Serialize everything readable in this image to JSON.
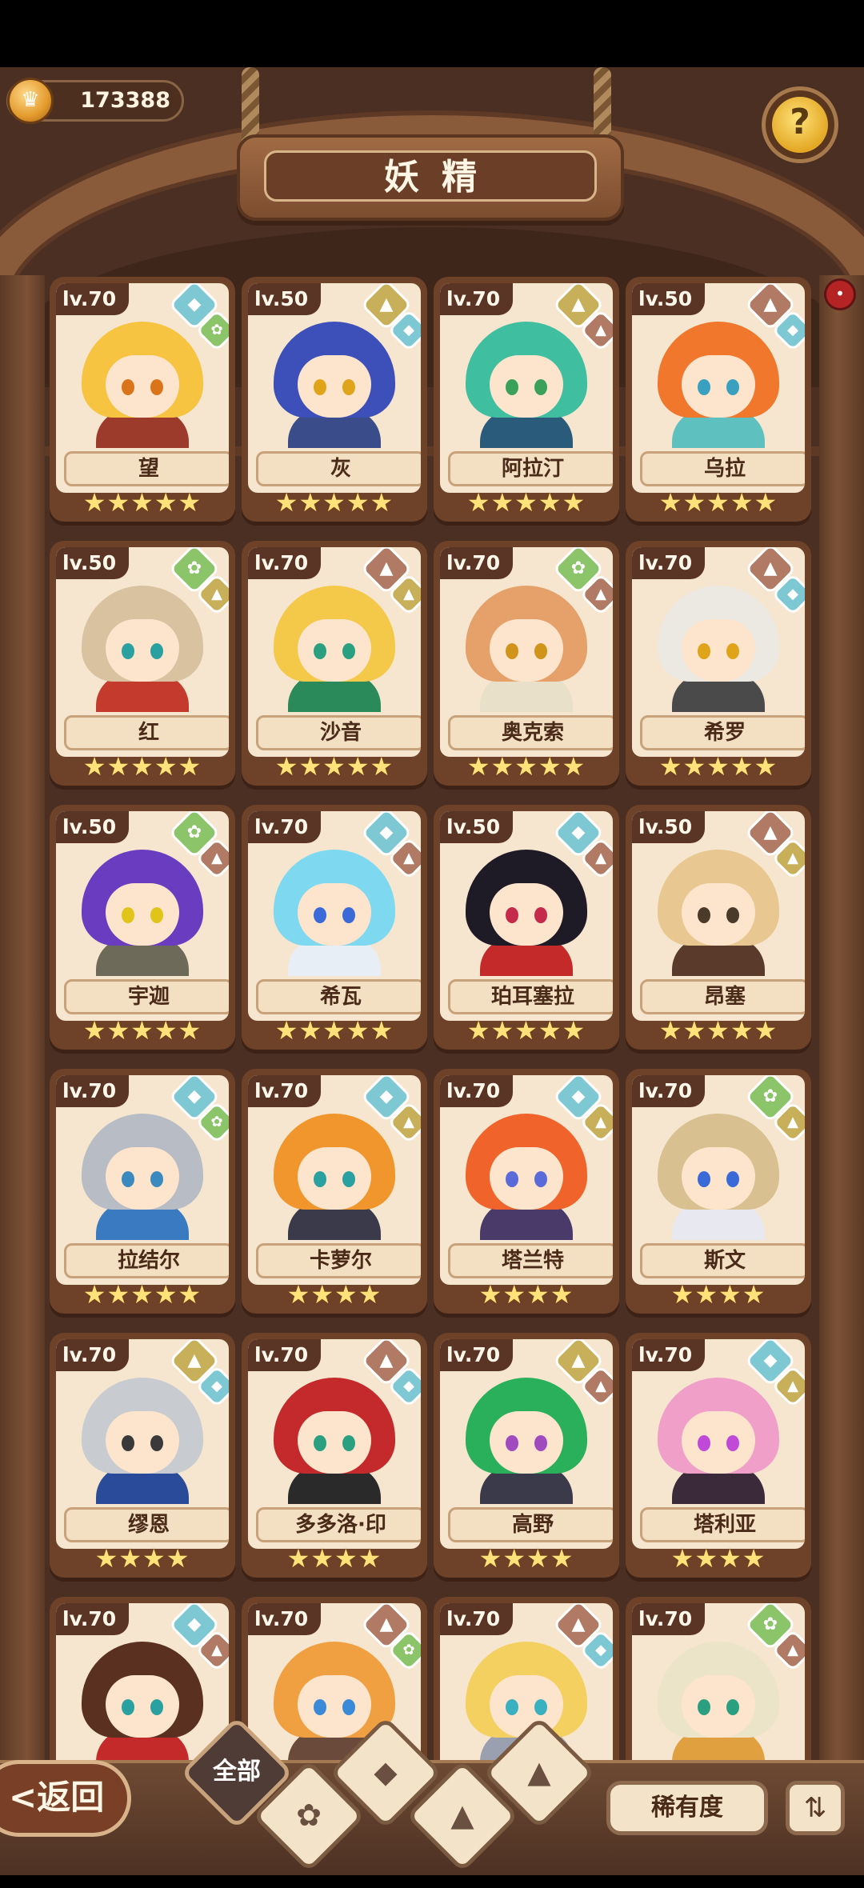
{
  "header": {
    "title": "妖精",
    "currency_value": "173388",
    "help_symbol": "?",
    "notification_mark": "•"
  },
  "footer": {
    "back_label": "<返回",
    "filter_all_label": "全部",
    "rarity_label": "稀有度",
    "sort_symbol": "⇅"
  },
  "element_colors": {
    "water": "#7ec8d4",
    "earth": "#c8b05a",
    "fire": "#b07a64",
    "nature": "#8cc46a"
  },
  "fairies": [
    {
      "level": "lv.70",
      "name": "望",
      "stars": "★★★★★",
      "elements": [
        "water",
        "nature"
      ],
      "hair": "#f6c441",
      "outfit": "#9c3a2c",
      "eye": "#d9741a"
    },
    {
      "level": "lv.50",
      "name": "灰",
      "stars": "★★★★★",
      "elements": [
        "earth",
        "water"
      ],
      "hair": "#3d4fb8",
      "outfit": "#3a4c8a",
      "eye": "#e0a41a"
    },
    {
      "level": "lv.70",
      "name": "阿拉汀",
      "stars": "★★★★★",
      "elements": [
        "earth",
        "fire"
      ],
      "hair": "#3fbfa0",
      "outfit": "#2a5b7a",
      "eye": "#3aa05a"
    },
    {
      "level": "lv.50",
      "name": "乌拉",
      "stars": "★★★★★",
      "elements": [
        "fire",
        "water"
      ],
      "hair": "#f0772c",
      "outfit": "#5fc0c0",
      "eye": "#3aa0c0"
    },
    {
      "level": "lv.50",
      "name": "红",
      "stars": "★★★★★",
      "elements": [
        "nature",
        "earth"
      ],
      "hair": "#d8c2a0",
      "outfit": "#c43a2c",
      "eye": "#2aa0a0"
    },
    {
      "level": "lv.70",
      "name": "沙音",
      "stars": "★★★★★",
      "elements": [
        "fire",
        "earth"
      ],
      "hair": "#f4c94a",
      "outfit": "#2a8a5a",
      "eye": "#2aa080"
    },
    {
      "level": "lv.70",
      "name": "奥克索",
      "stars": "★★★★★",
      "elements": [
        "nature",
        "fire"
      ],
      "hair": "#e6a06a",
      "outfit": "#e8e0c8",
      "eye": "#d0941a"
    },
    {
      "level": "lv.70",
      "name": "希罗",
      "stars": "★★★★★",
      "elements": [
        "fire",
        "water"
      ],
      "hair": "#ece8e2",
      "outfit": "#4a4a4a",
      "eye": "#e0a41a"
    },
    {
      "level": "lv.50",
      "name": "宇迦",
      "stars": "★★★★★",
      "elements": [
        "nature",
        "fire"
      ],
      "hair": "#6a3cc0",
      "outfit": "#6e6a5a",
      "eye": "#e0c41a"
    },
    {
      "level": "lv.70",
      "name": "希瓦",
      "stars": "★★★★★",
      "elements": [
        "water",
        "fire"
      ],
      "hair": "#7ed8f0",
      "outfit": "#e8eef6",
      "eye": "#3a6ad8"
    },
    {
      "level": "lv.50",
      "name": "珀耳塞拉",
      "stars": "★★★★★",
      "elements": [
        "water",
        "fire"
      ],
      "hair": "#1e1a26",
      "outfit": "#c42a2a",
      "eye": "#c42a4a"
    },
    {
      "level": "lv.50",
      "name": "昂塞",
      "stars": "★★★★★",
      "elements": [
        "fire",
        "earth"
      ],
      "hair": "#e8c890",
      "outfit": "#5a3a2a",
      "eye": "#4a3a2a"
    },
    {
      "level": "lv.70",
      "name": "拉结尔",
      "stars": "★★★★★",
      "elements": [
        "water",
        "nature"
      ],
      "hair": "#b8bcc4",
      "outfit": "#3a7ac0",
      "eye": "#3a8ac0"
    },
    {
      "level": "lv.70",
      "name": "卡萝尔",
      "stars": "★★★★",
      "elements": [
        "water",
        "earth"
      ],
      "hair": "#f0962c",
      "outfit": "#3a3a4a",
      "eye": "#2aa0a0"
    },
    {
      "level": "lv.70",
      "name": "塔兰特",
      "stars": "★★★★",
      "elements": [
        "water",
        "earth"
      ],
      "hair": "#f0642c",
      "outfit": "#4a3a6a",
      "eye": "#5a6ad8"
    },
    {
      "level": "lv.70",
      "name": "斯文",
      "stars": "★★★★",
      "elements": [
        "nature",
        "earth"
      ],
      "hair": "#d8c090",
      "outfit": "#e8e8f0",
      "eye": "#3a6ad8"
    },
    {
      "level": "lv.70",
      "name": "缪恩",
      "stars": "★★★★",
      "elements": [
        "earth",
        "water"
      ],
      "hair": "#c8ccd0",
      "outfit": "#2a4a9a",
      "eye": "#3a3a3a"
    },
    {
      "level": "lv.70",
      "name": "多多洛·印",
      "stars": "★★★★",
      "elements": [
        "fire",
        "water"
      ],
      "hair": "#c42a2c",
      "outfit": "#2a2a2a",
      "eye": "#2aa080"
    },
    {
      "level": "lv.70",
      "name": "高野",
      "stars": "★★★★",
      "elements": [
        "earth",
        "fire"
      ],
      "hair": "#2ab05a",
      "outfit": "#3a3a4a",
      "eye": "#a04ac0"
    },
    {
      "level": "lv.70",
      "name": "塔利亚",
      "stars": "★★★★",
      "elements": [
        "water",
        "earth"
      ],
      "hair": "#f0a0c8",
      "outfit": "#3a2a3a",
      "eye": "#c04ad8"
    },
    {
      "level": "lv.70",
      "name": "",
      "stars": "",
      "elements": [
        "water",
        "fire"
      ],
      "hair": "#5a3020",
      "outfit": "#c42a2a",
      "eye": "#2aa0a0"
    },
    {
      "level": "lv.70",
      "name": "",
      "stars": "",
      "elements": [
        "fire",
        "nature"
      ],
      "hair": "#f0a040",
      "outfit": "#6a4a3a",
      "eye": "#3a8ad8"
    },
    {
      "level": "lv.70",
      "name": "",
      "stars": "",
      "elements": [
        "fire",
        "water"
      ],
      "hair": "#f4d060",
      "outfit": "#9aa0b0",
      "eye": "#3ab0c0"
    },
    {
      "level": "lv.70",
      "name": "",
      "stars": "",
      "elements": [
        "nature",
        "fire"
      ],
      "hair": "#ece4c8",
      "outfit": "#e0a040",
      "eye": "#2aa080"
    }
  ]
}
